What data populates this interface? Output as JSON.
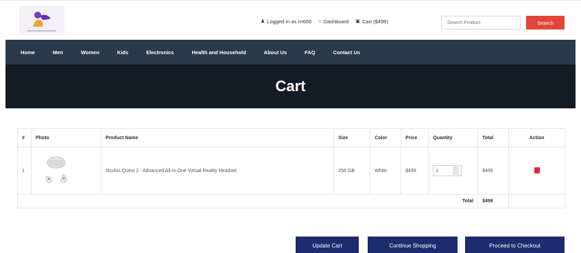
{
  "header": {
    "logged_in": "Logged in as rrr666",
    "dashboard": "Dashboard",
    "cart": "Cart ($499)",
    "search_placeholder": "Search Product",
    "search_button": "Search"
  },
  "nav": {
    "items": [
      "Home",
      "Men",
      "Women",
      "Kids",
      "Electronics",
      "Health and Household",
      "About Us",
      "FAQ",
      "Contact Us"
    ]
  },
  "banner": {
    "title": "Cart"
  },
  "table": {
    "headers": [
      "#",
      "Photo",
      "Product Name",
      "Size",
      "Color",
      "Price",
      "Quantity",
      "Total",
      "Action"
    ],
    "row": {
      "num": "1",
      "name": "Oculus Quest 2 - Advanced All-in-One Virtual Reality Headset",
      "size": "256 GB",
      "color": "White",
      "price": "$499",
      "quantity": "1",
      "total": "$499"
    },
    "total_label": "Total",
    "total_value": "$499"
  },
  "buttons": {
    "update": "Update Cart",
    "continue": "Continue Shopping",
    "checkout": "Proceed to Checkout"
  },
  "colors": {
    "nav_bg": "#2b3a48",
    "banner_bg": "#131b24",
    "search_button": "#e2453c",
    "primary_button": "#1d2c6e",
    "delete_icon": "#e2263a"
  },
  "icons": {
    "logged_in": "user-icon",
    "dashboard": "home-icon",
    "cart": "cart-icon",
    "action": "trash-icon"
  }
}
